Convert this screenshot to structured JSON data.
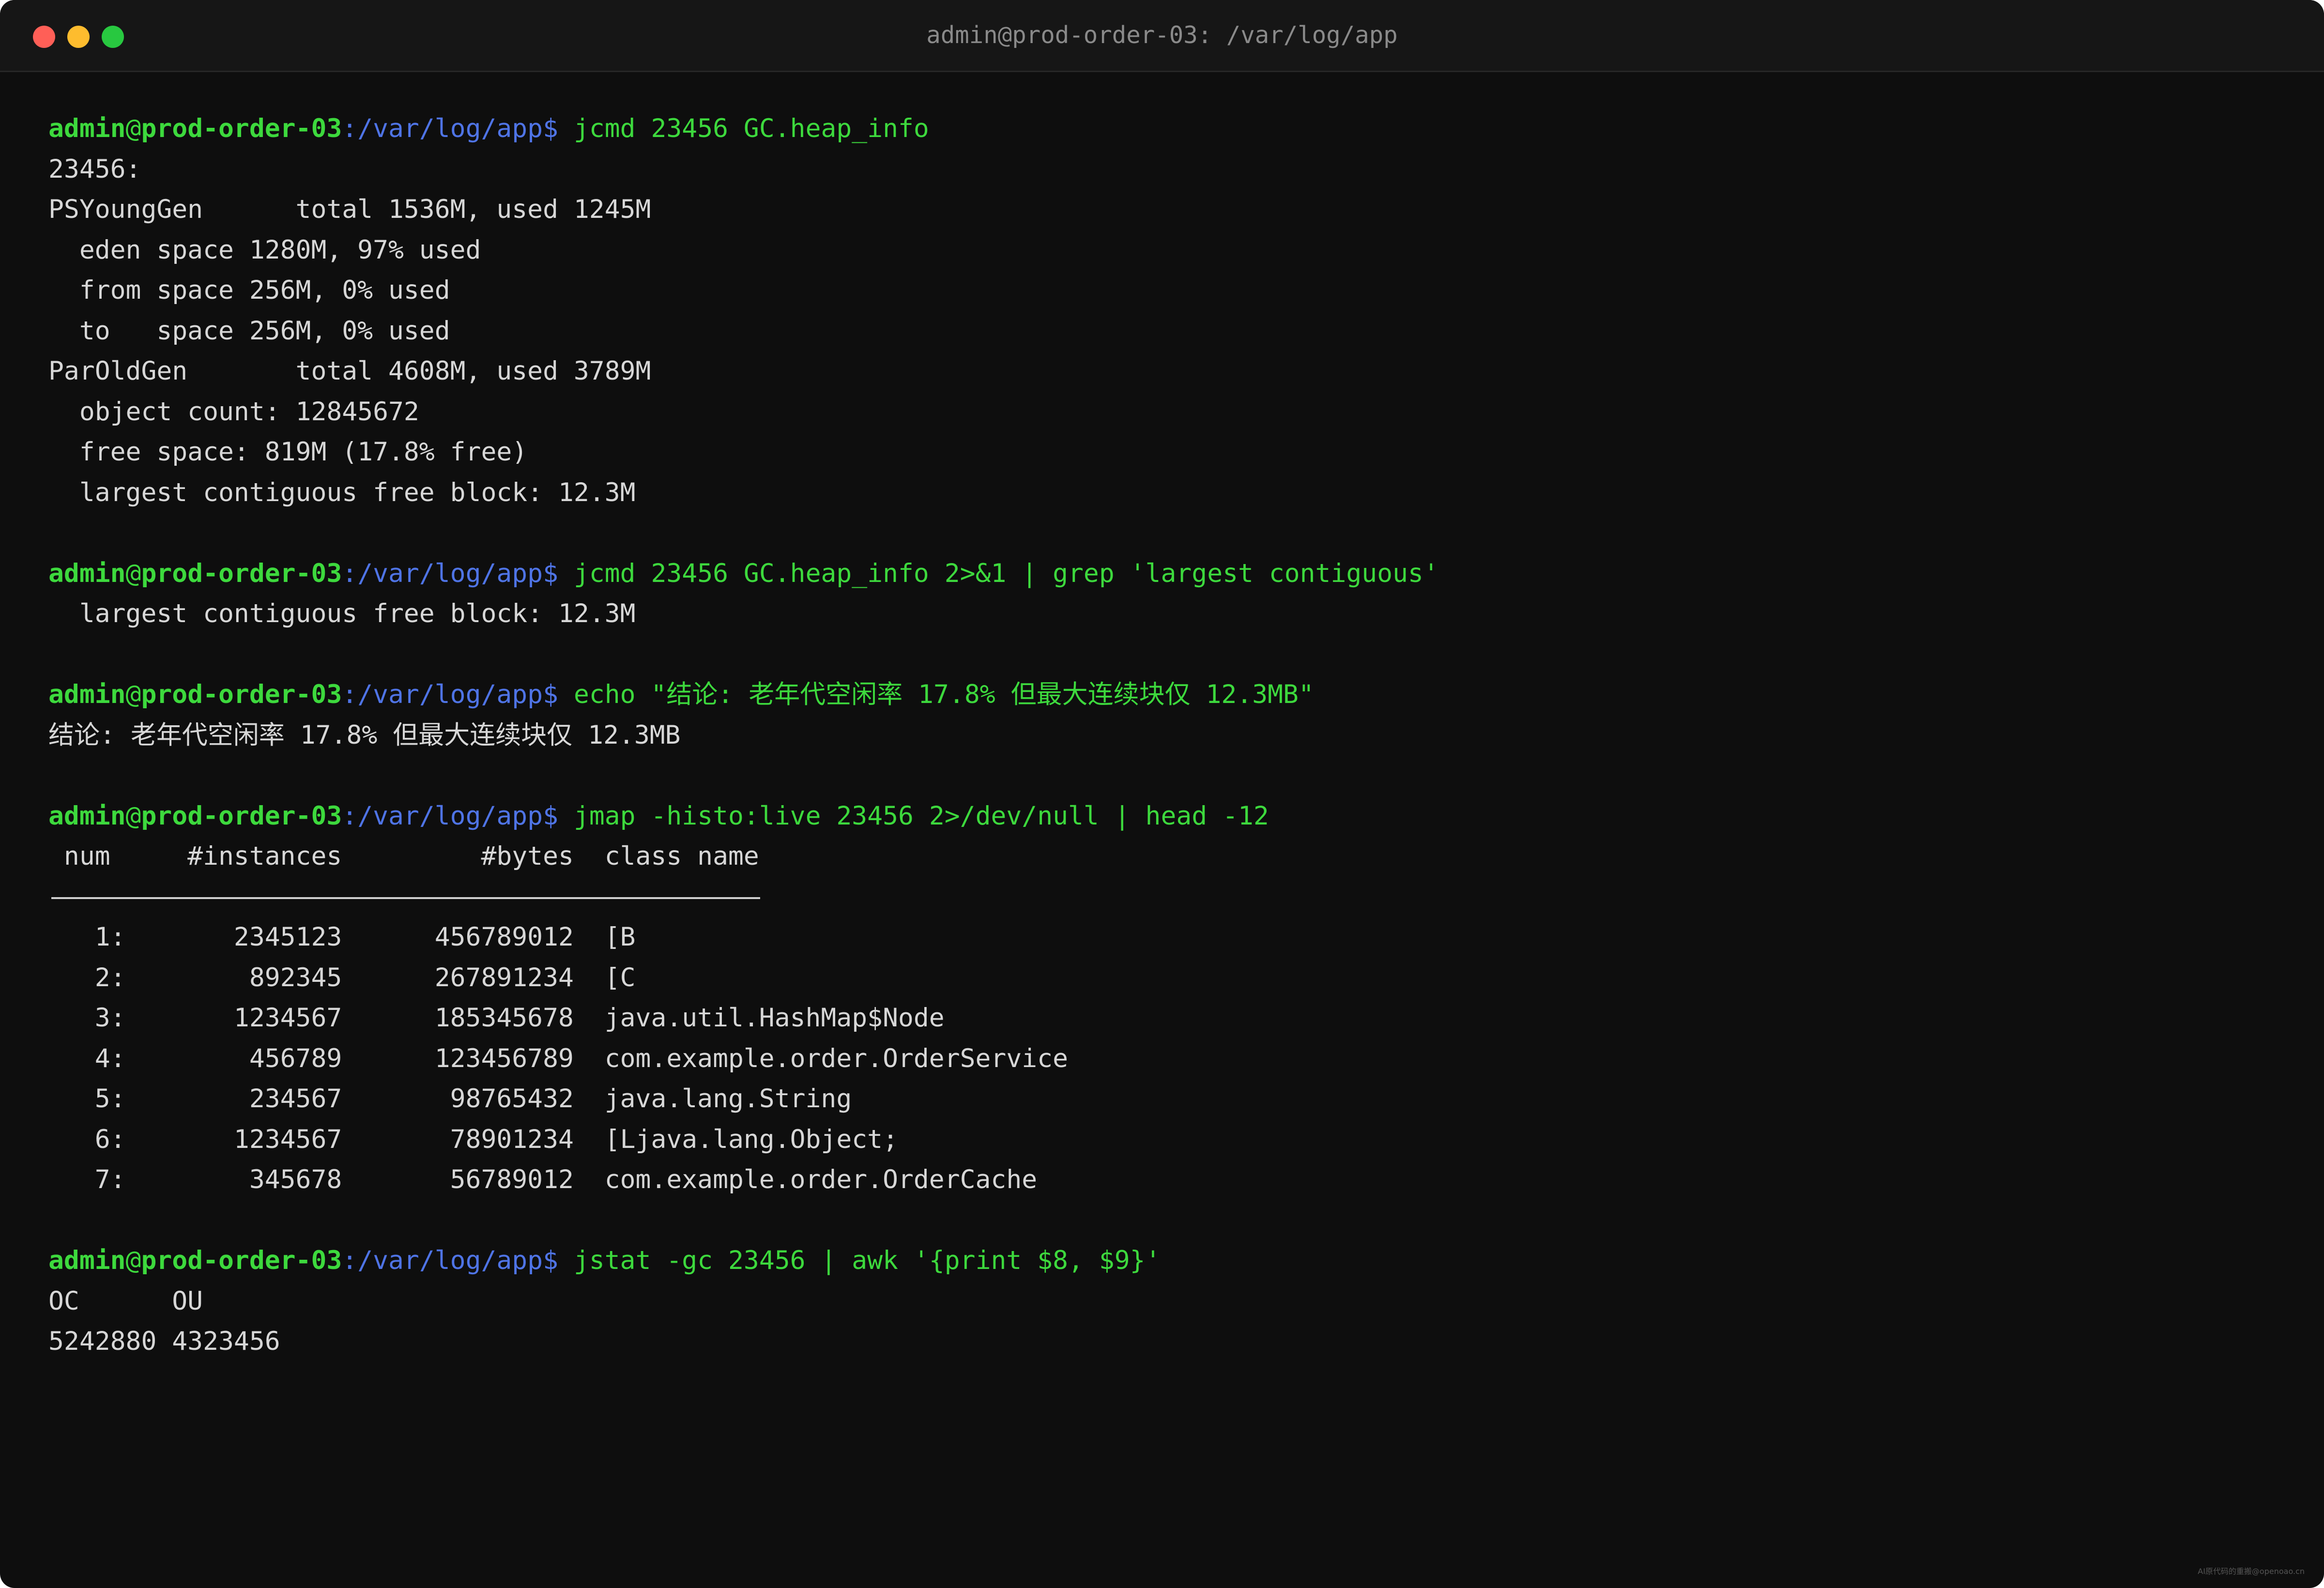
{
  "window": {
    "title": "admin@prod-order-03: /var/log/app"
  },
  "prompt": {
    "user": "admin",
    "at": "@",
    "host": "prod-order-03",
    "path": ":/var/log/app$"
  },
  "blocks": [
    {
      "command": " jcmd 23456 GC.heap_info",
      "output": [
        "23456:",
        "PSYoungGen      total 1536M, used 1245M",
        "  eden space 1280M, 97% used",
        "  from space 256M, 0% used",
        "  to   space 256M, 0% used",
        "ParOldGen       total 4608M, used 3789M",
        "  object count: 12845672",
        "  free space: 819M (17.8% free)",
        "  largest contiguous free block: 12.3M"
      ]
    },
    {
      "command": " jcmd 23456 GC.heap_info 2>&1 | grep 'largest contiguous'",
      "output": [
        "  largest contiguous free block: 12.3M"
      ]
    },
    {
      "command": " echo \"结论: 老年代空闲率 17.8% 但最大连续块仅 12.3MB\"",
      "output": [
        "结论: 老年代空闲率 17.8% 但最大连续块仅 12.3MB"
      ]
    },
    {
      "command": " jmap -histo:live 23456 2>/dev/null | head -12",
      "header": " num     #instances         #bytes  class name",
      "rows": [
        "   1:       2345123      456789012  [B",
        "   2:        892345      267891234  [C",
        "   3:       1234567      185345678  java.util.HashMap$Node",
        "   4:        456789      123456789  com.example.order.OrderService",
        "   5:        234567       98765432  java.lang.String",
        "   6:       1234567       78901234  [Ljava.lang.Object;",
        "   7:        345678       56789012  com.example.order.OrderCache"
      ]
    },
    {
      "command": " jstat -gc 23456 | awk '{print $8, $9}'",
      "output": [
        "OC      OU",
        "5242880 4323456"
      ]
    }
  ],
  "watermark": "AI原代码的重搬@openoao.cn"
}
